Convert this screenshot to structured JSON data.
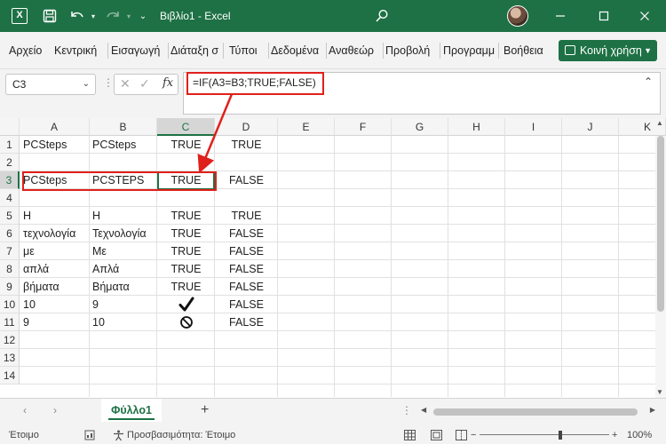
{
  "window": {
    "title": "Βιβλίο1  -  Excel",
    "accent": "#1e7145"
  },
  "ribbon": {
    "tabs": [
      "Αρχείο",
      "Κεντρική",
      "Εισαγωγή",
      "Διάταξη σ",
      "Τύποι",
      "Δεδομένα",
      "Αναθεώρ",
      "Προβολή",
      "Προγραμμ",
      "Βοήθεια"
    ],
    "share_label": "Κοινή χρήση"
  },
  "formula_bar": {
    "name_box": "C3",
    "fx_label": "fx",
    "formula": "=IF(A3=B3;TRUE;FALSE)"
  },
  "grid": {
    "columns": [
      "A",
      "B",
      "C",
      "D",
      "E",
      "F",
      "G",
      "H",
      "I",
      "J",
      "K"
    ],
    "selected_column": "C",
    "rows": [
      "1",
      "2",
      "3",
      "4",
      "5",
      "6",
      "7",
      "8",
      "9",
      "10",
      "11",
      "12",
      "13",
      "14"
    ],
    "selected_row": "3",
    "cells": {
      "A1": "PCSteps",
      "B1": "PCSteps",
      "C1": "TRUE",
      "D1": "TRUE",
      "A3": "PCSteps",
      "B3": "PCSTEPS",
      "C3": "TRUE",
      "D3": "FALSE",
      "A5": "Η",
      "B5": "Η",
      "C5": "TRUE",
      "D5": "TRUE",
      "A6": "τεχνολογία",
      "B6": "Τεχνολογία",
      "C6": "TRUE",
      "D6": "FALSE",
      "A7": "με",
      "B7": "Με",
      "C7": "TRUE",
      "D7": "FALSE",
      "A8": "απλά",
      "B8": "Απλά",
      "C8": "TRUE",
      "D8": "FALSE",
      "A9": "βήματα",
      "B9": "Βήματα",
      "C9": "TRUE",
      "D9": "FALSE",
      "A10": "10",
      "B10": "9",
      "D10": "FALSE",
      "A11": "9",
      "B11": "10",
      "D11": "FALSE"
    },
    "c10_icon": "check-mark-icon",
    "c11_icon": "prohibited-icon"
  },
  "sheets": {
    "tabs": [
      "Φύλλο1"
    ],
    "add_label": "+"
  },
  "status": {
    "ready": "Έτοιμο",
    "accessibility": "Προσβασιμότητα: Έτοιμο",
    "zoom": "100%"
  }
}
